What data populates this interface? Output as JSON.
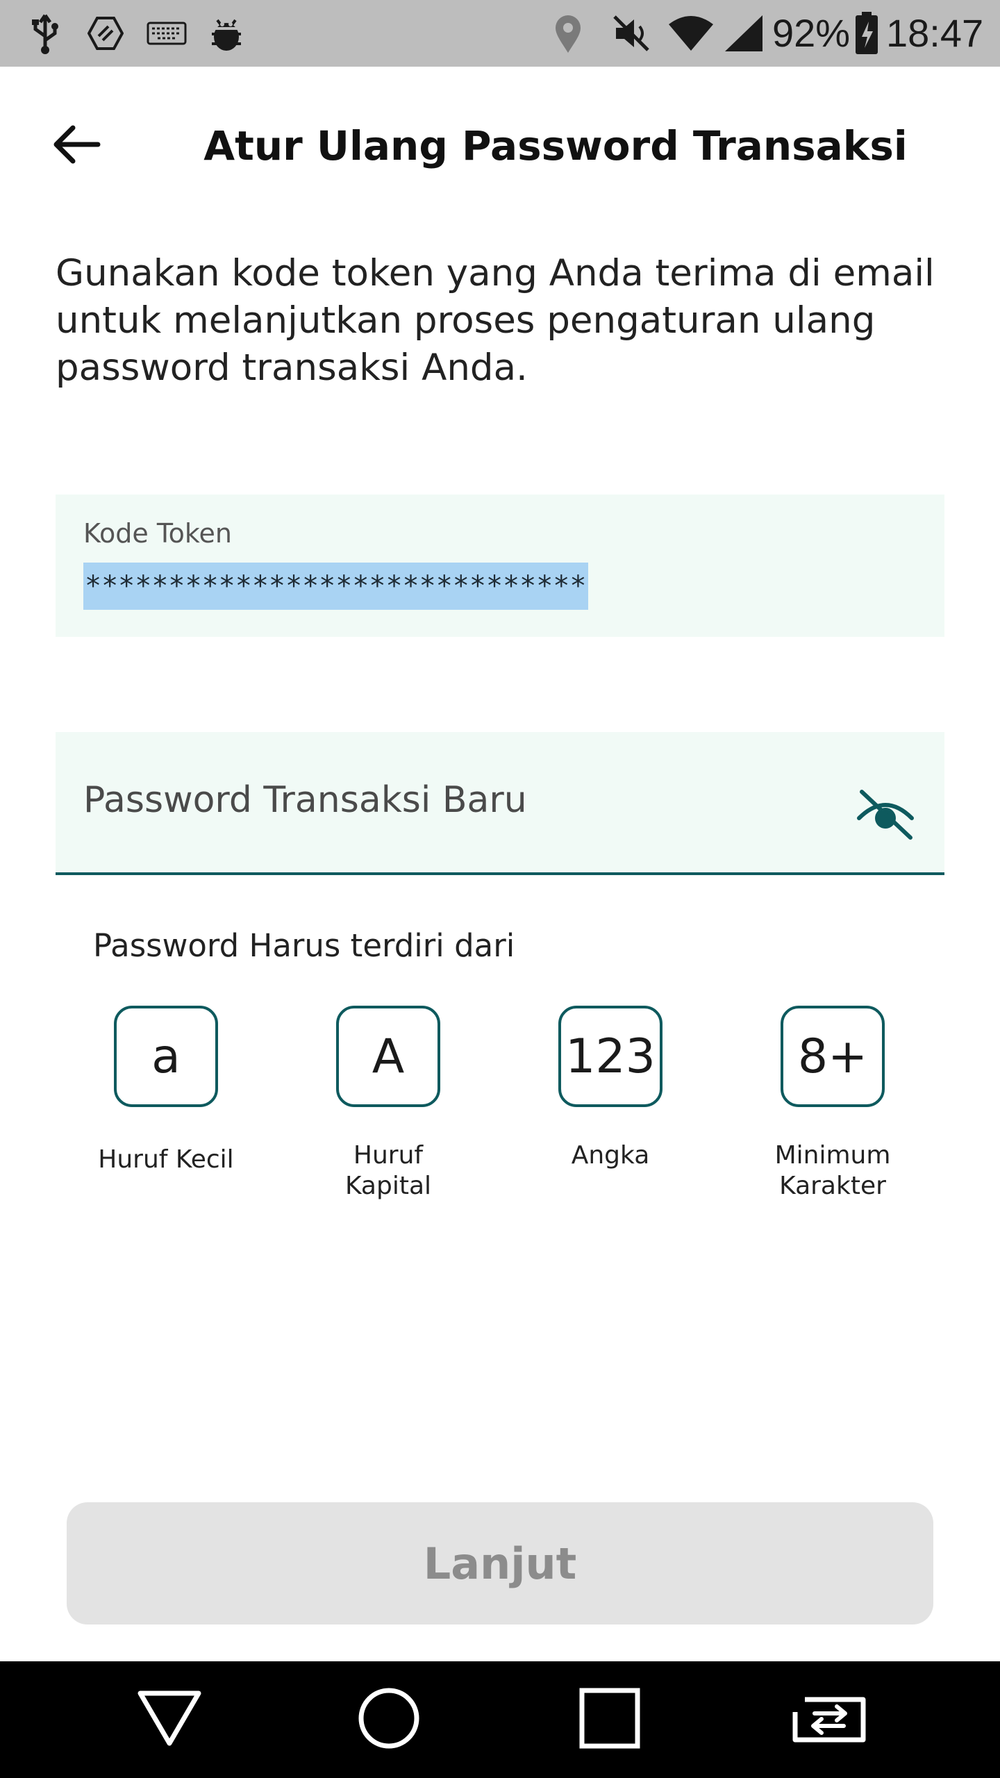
{
  "status_bar": {
    "icons": [
      "usb-icon",
      "transfer-icon",
      "keyboard-icon",
      "android-debug-icon",
      "location-icon",
      "mute-icon",
      "wifi-icon",
      "signal-icon",
      "battery-icon"
    ],
    "battery": "92%",
    "time": "18:47"
  },
  "header": {
    "back_icon": "arrow-left-icon",
    "title": "Atur Ulang Password Transaksi"
  },
  "instruction": "Gunakan kode token yang Anda terima di email untuk melanjutkan proses pengaturan ulang password transaksi Anda.",
  "token_field": {
    "label": "Kode Token",
    "value": "********************************"
  },
  "password_field": {
    "placeholder": "Password Transaksi Baru",
    "toggle_icon": "eye-off-icon"
  },
  "requirements": {
    "heading": "Password Harus terdiri dari",
    "items": [
      {
        "symbol": "a",
        "label": "Huruf Kecil"
      },
      {
        "symbol": "A",
        "label": "Huruf\nKapital"
      },
      {
        "symbol": "123",
        "label": "Angka"
      },
      {
        "symbol": "8+",
        "label": "Minimum\nKarakter"
      }
    ]
  },
  "next_button": {
    "label": "Lanjut",
    "state": "disabled"
  },
  "nav_bar": {
    "icons": [
      "back-triangle-icon",
      "home-circle-icon",
      "recents-square-icon",
      "switch-app-icon"
    ]
  },
  "colors": {
    "accent": "#0e5a5e",
    "field_background": "#f1faf6",
    "selection": "#a9d3f3",
    "button_disabled": "#e3e3e3",
    "status_bar": "#bdbdbd"
  }
}
